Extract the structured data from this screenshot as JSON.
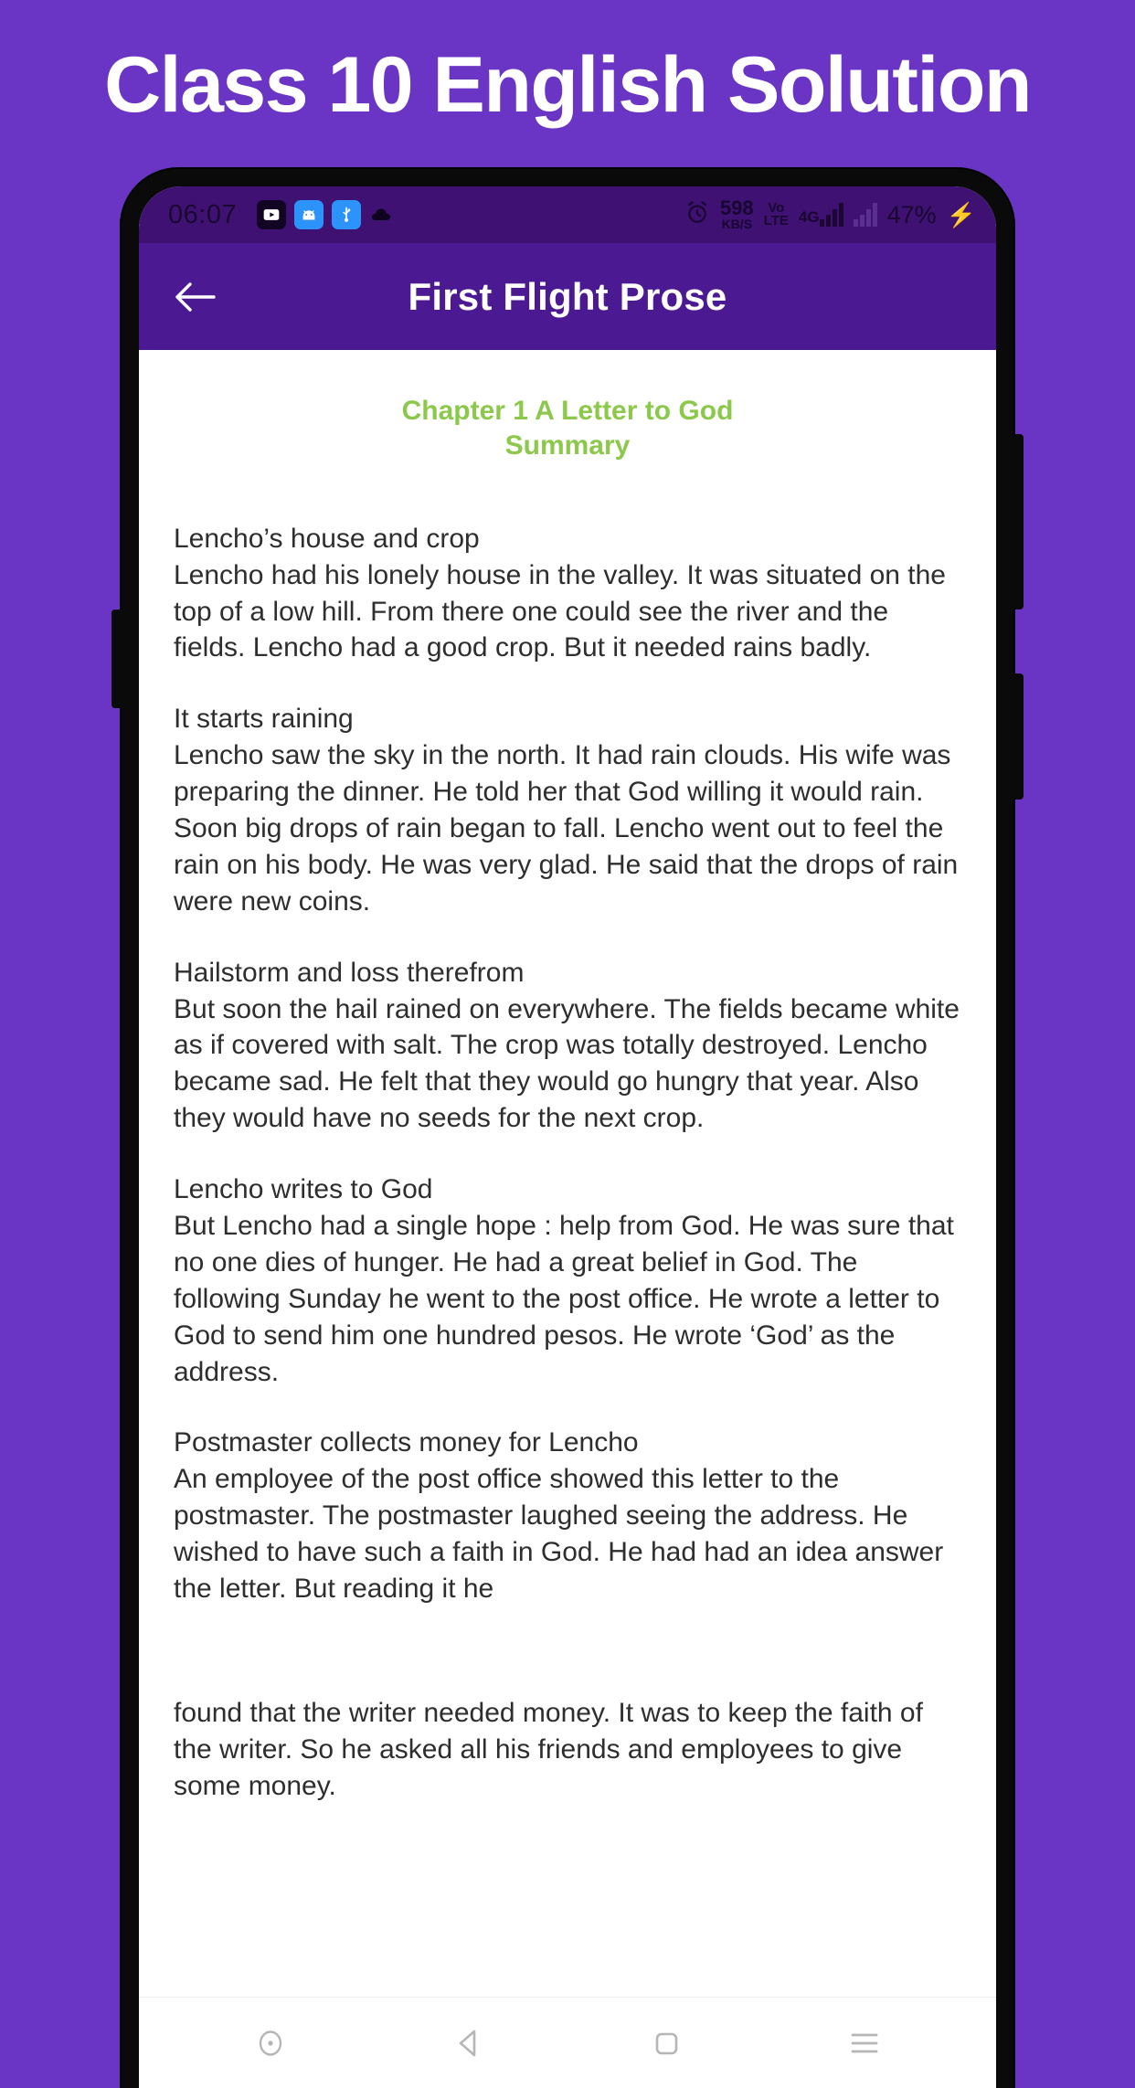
{
  "banner": {
    "title": "Class 10 English Solution",
    "background_color": "#6A35C4",
    "text_color": "#FFFFFF"
  },
  "status_bar": {
    "clock": "06:07",
    "background_color": "#3E1173",
    "left_icons": [
      {
        "name": "youtube-icon",
        "glyph": "▶"
      },
      {
        "name": "android-icon",
        "glyph": "■"
      },
      {
        "name": "usb-icon",
        "glyph": "■"
      },
      {
        "name": "cloud-icon",
        "glyph": "▲"
      }
    ],
    "alarm_icon": "alarm-icon",
    "data_speed_value": "598",
    "data_speed_unit": "KB/S",
    "volte_line1": "Vo",
    "volte_line2": "LTE",
    "network_type": "4G",
    "battery_percent": "47%",
    "charging_glyph": "⚡"
  },
  "app_bar": {
    "title": "First Flight Prose",
    "back_icon": "back-arrow-icon",
    "background_color": "#4B1A92",
    "text_color": "#FFFFFF"
  },
  "chapter": {
    "heading_line1": "Chapter 1 A Letter to God",
    "heading_line2": "Summary",
    "heading_color": "#8CC84B"
  },
  "paragraphs": [
    {
      "heading": "Lencho’s house and crop",
      "body": "Lencho had his lonely house in the valley. It was situated on the top of a low hill. From there one could see the river and the fields. Lencho had a good crop. But it needed rains badly."
    },
    {
      "heading": "It starts raining",
      "body": "Lencho saw the sky in the north. It had rain clouds. His wife was preparing the dinner. He told her that God willing it would rain. Soon big drops of rain began to fall. Lencho went out to feel the rain on his body. He was very glad. He said that the drops of rain were new coins."
    },
    {
      "heading": "Hailstorm and loss therefrom",
      "body": "But soon the hail rained on everywhere. The fields became white as if covered with salt. The crop was totally destroyed. Lencho became sad. He felt that they would go hungry that year. Also they would have no seeds for the next crop."
    },
    {
      "heading": "Lencho writes to God",
      "body": "But Lencho had a single hope : help from God. He was sure that no one dies of hunger. He had a great belief in God. The following Sunday he went to the post office. He wrote a letter to God to send him one hundred pesos. He wrote ‘God’ as the address."
    },
    {
      "heading": "Postmaster collects money for Lencho",
      "body": "An employee of the post office showed this letter to the postmaster. The postmaster laughed seeing the address. He wished to have such a faith in God. He had had an idea answer the letter. But reading it he"
    }
  ],
  "continuation_paragraph": "found that the writer needed money. It was to keep the faith of the writer. So he asked all his friends and employees to give some money.",
  "nav_bar": {
    "buttons": [
      {
        "name": "assistant-circle-icon"
      },
      {
        "name": "back-triangle-icon"
      },
      {
        "name": "home-square-icon"
      },
      {
        "name": "recents-menu-icon"
      }
    ]
  }
}
